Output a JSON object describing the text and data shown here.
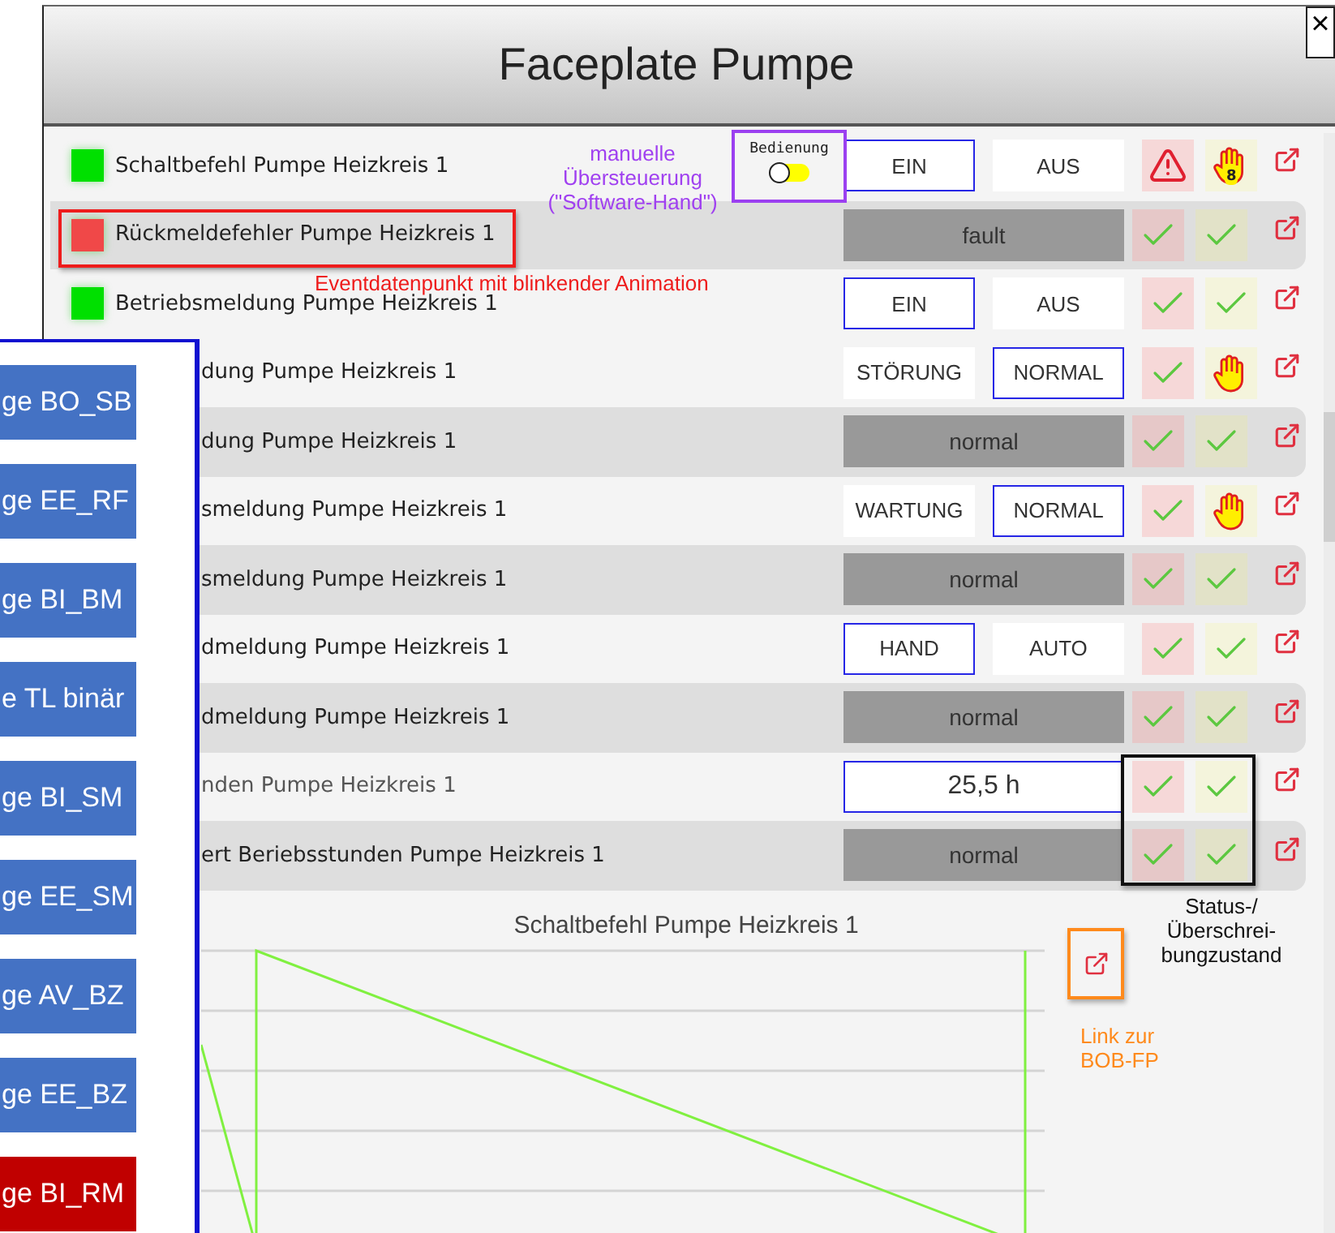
{
  "window": {
    "title": "Faceplate Pumpe",
    "close": "×"
  },
  "mode_toggle": {
    "label": "Bedienung",
    "on": false
  },
  "rows": [
    {
      "label": "Schaltbefehl Pumpe Heizkreis 1",
      "color": "#00e000",
      "kind": "switch",
      "options": [
        {
          "label": "EIN",
          "selected": true
        },
        {
          "label": "AUS",
          "selected": false
        }
      ],
      "status": [
        {
          "kind": "warning"
        },
        {
          "kind": "hand_count",
          "count": "8"
        }
      ]
    },
    {
      "label": "Rückmeldefehler Pumpe Heizkreis 1",
      "color": "#f04848",
      "kind": "value",
      "value": "fault",
      "status": [
        {
          "kind": "check"
        },
        {
          "kind": "check"
        }
      ]
    },
    {
      "label": "Betriebsmeldung Pumpe Heizkreis 1",
      "color": "#00e000",
      "kind": "switch",
      "options": [
        {
          "label": "EIN",
          "selected": true
        },
        {
          "label": "AUS",
          "selected": false
        }
      ],
      "status": [
        {
          "kind": "check"
        },
        {
          "kind": "check"
        }
      ]
    },
    {
      "label": "dung Pumpe Heizkreis 1",
      "kind": "switch",
      "options": [
        {
          "label": "STÖRUNG",
          "selected": false
        },
        {
          "label": "NORMAL",
          "selected": true
        }
      ],
      "status": [
        {
          "kind": "check"
        },
        {
          "kind": "hand"
        }
      ]
    },
    {
      "label": "dung Pumpe Heizkreis 1",
      "kind": "value",
      "value": "normal",
      "status": [
        {
          "kind": "check"
        },
        {
          "kind": "check"
        }
      ]
    },
    {
      "label": "smeldung Pumpe Heizkreis 1",
      "kind": "switch",
      "options": [
        {
          "label": "WARTUNG",
          "selected": false
        },
        {
          "label": "NORMAL",
          "selected": true
        }
      ],
      "status": [
        {
          "kind": "check"
        },
        {
          "kind": "hand"
        }
      ]
    },
    {
      "label": "smeldung Pumpe Heizkreis 1",
      "kind": "value",
      "value": "normal",
      "status": [
        {
          "kind": "check"
        },
        {
          "kind": "check"
        }
      ]
    },
    {
      "label": "dmeldung Pumpe Heizkreis 1",
      "kind": "switch",
      "options": [
        {
          "label": "HAND",
          "selected": true
        },
        {
          "label": "AUTO",
          "selected": false
        }
      ],
      "status": [
        {
          "kind": "check"
        },
        {
          "kind": "check"
        }
      ]
    },
    {
      "label": "dmeldung Pumpe Heizkreis 1",
      "kind": "value",
      "value": "normal",
      "status": [
        {
          "kind": "check"
        },
        {
          "kind": "check"
        }
      ]
    },
    {
      "label": "nden Pumpe Heizkreis 1",
      "kind": "input",
      "value": "25,5 h",
      "status": [
        {
          "kind": "check"
        },
        {
          "kind": "check"
        }
      ]
    },
    {
      "label": "ert Beriebsstunden Pumpe Heizkreis 1",
      "kind": "value",
      "value": "normal",
      "status": [
        {
          "kind": "check"
        },
        {
          "kind": "check"
        }
      ]
    }
  ],
  "chart": {
    "title": "Schaltbefehl Pumpe Heizkreis 1"
  },
  "annotations": {
    "override": [
      "manuelle",
      "Übersteuerung",
      "(\"Software-Hand\")"
    ],
    "event": [
      "Eventdatenpunkt mit blinkender Animation"
    ],
    "status": [
      "Status-/",
      "Überschrei-",
      "bungzustand"
    ],
    "link": [
      "Link zur",
      "BOB-FP"
    ]
  },
  "side_panel": {
    "buttons": [
      {
        "label": "ge BO_SB",
        "color": "#4472c4"
      },
      {
        "label": "ge EE_RF",
        "color": "#4472c4"
      },
      {
        "label": "ge BI_BM",
        "color": "#4472c4"
      },
      {
        "label": "e TL binär",
        "color": "#4472c4"
      },
      {
        "label": "ge BI_SM",
        "color": "#4472c4"
      },
      {
        "label": "ge EE_SM",
        "color": "#4472c4"
      },
      {
        "label": "ge AV_BZ",
        "color": "#4472c4"
      },
      {
        "label": "ge EE_BZ",
        "color": "#4472c4"
      },
      {
        "label": "ge BI_RM",
        "color": "#c00000"
      }
    ]
  }
}
